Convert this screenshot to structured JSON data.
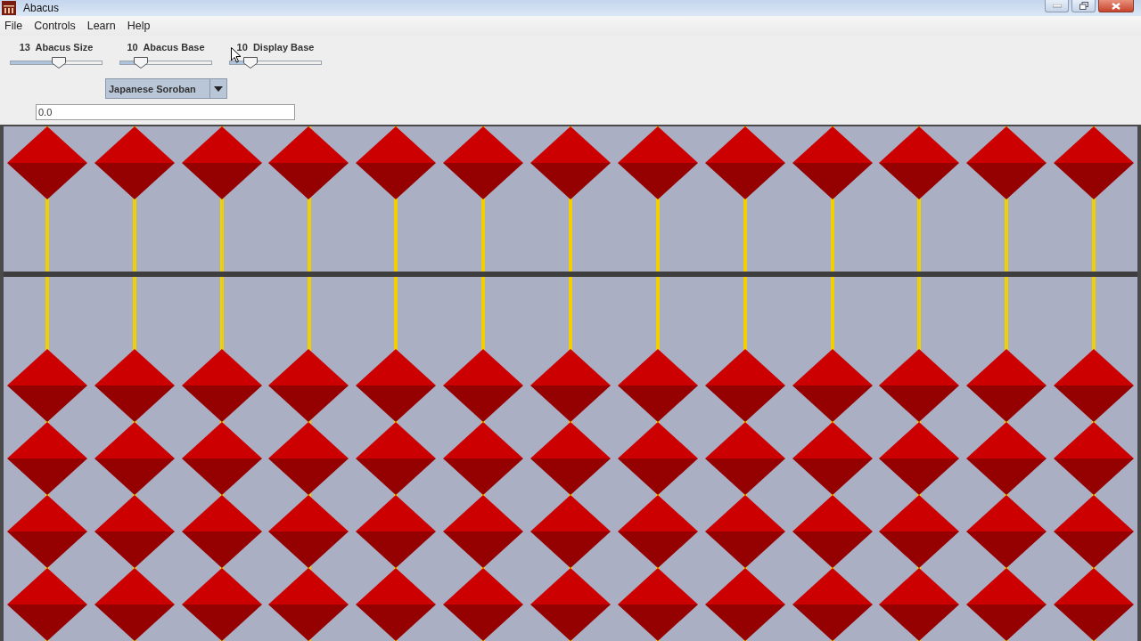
{
  "window": {
    "title": "Abacus"
  },
  "menu": [
    "File",
    "Controls",
    "Learn",
    "Help"
  ],
  "sliders": [
    {
      "value": "13",
      "label": "Abacus Size",
      "level": 0.53
    },
    {
      "value": "10",
      "label": "Abacus Base",
      "level": 0.23
    },
    {
      "value": "10",
      "label": "Display Base",
      "level": 0.23
    }
  ],
  "abacus_type": {
    "value": "Japanese Soroban"
  },
  "display": {
    "value": "0.0"
  },
  "rods": [
    {
      "heaven_bead_down": false
    },
    {
      "heaven_bead_down": false
    },
    {
      "heaven_bead_down": false
    },
    {
      "heaven_bead_down": false
    },
    {
      "heaven_bead_down": false
    },
    {
      "heaven_bead_down": false
    },
    {
      "heaven_bead_down": false
    },
    {
      "heaven_bead_down": false
    },
    {
      "heaven_bead_down": false
    },
    {
      "heaven_bead_down": false
    },
    {
      "heaven_bead_down": false
    },
    {
      "heaven_bead_down": false
    },
    {
      "heaven_bead_down": false
    }
  ]
}
